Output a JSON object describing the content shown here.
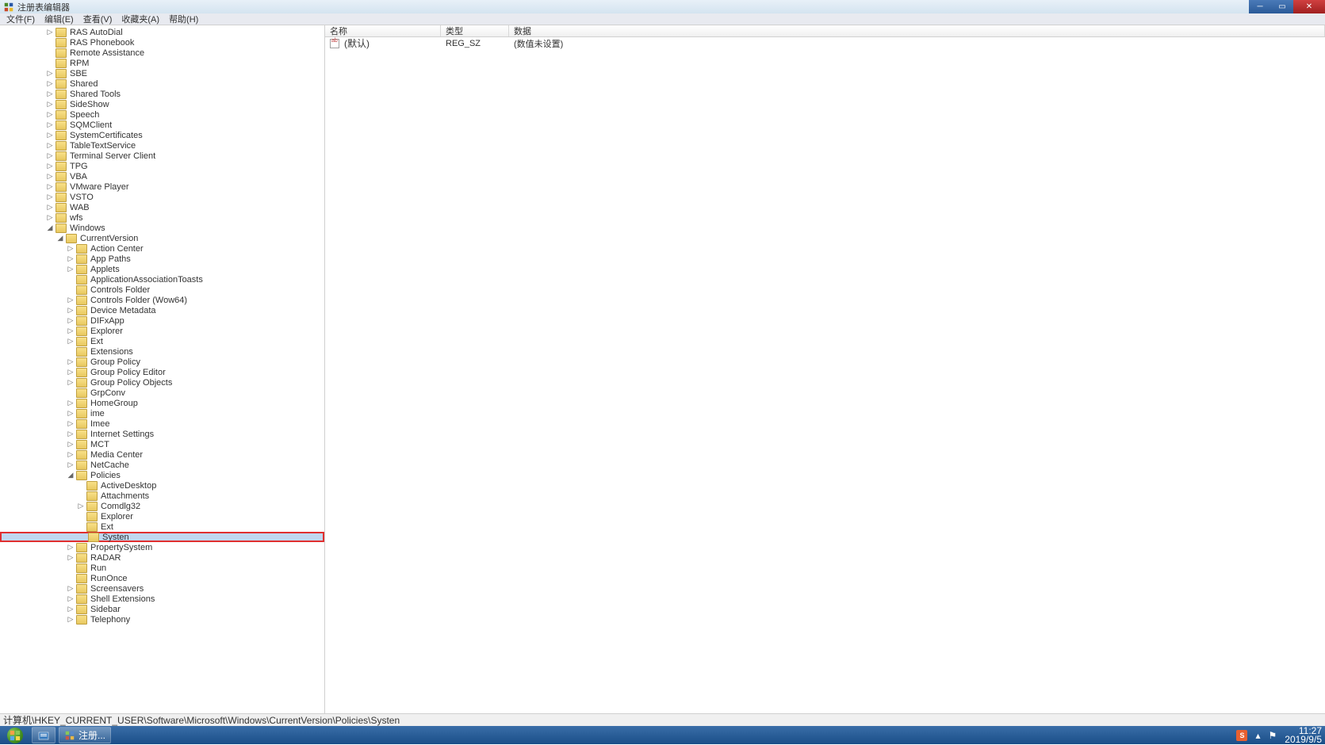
{
  "window": {
    "title": "注册表编辑器"
  },
  "menu": {
    "file": "文件(F)",
    "edit": "编辑(E)",
    "view": "查看(V)",
    "favorites": "收藏夹(A)",
    "help": "帮助(H)"
  },
  "tree": {
    "level0": [
      {
        "label": "RAS AutoDial",
        "expand": "▷"
      },
      {
        "label": "RAS Phonebook",
        "expand": ""
      },
      {
        "label": "Remote Assistance",
        "expand": ""
      },
      {
        "label": "RPM",
        "expand": ""
      },
      {
        "label": "SBE",
        "expand": "▷"
      },
      {
        "label": "Shared",
        "expand": "▷"
      },
      {
        "label": "Shared Tools",
        "expand": "▷"
      },
      {
        "label": "SideShow",
        "expand": "▷"
      },
      {
        "label": "Speech",
        "expand": "▷"
      },
      {
        "label": "SQMClient",
        "expand": "▷"
      },
      {
        "label": "SystemCertificates",
        "expand": "▷"
      },
      {
        "label": "TableTextService",
        "expand": "▷"
      },
      {
        "label": "Terminal Server Client",
        "expand": "▷"
      },
      {
        "label": "TPG",
        "expand": "▷"
      },
      {
        "label": "VBA",
        "expand": "▷"
      },
      {
        "label": "VMware Player",
        "expand": "▷"
      },
      {
        "label": "VSTO",
        "expand": "▷"
      },
      {
        "label": "WAB",
        "expand": "▷"
      },
      {
        "label": "wfs",
        "expand": "▷"
      }
    ],
    "windows": {
      "label": "Windows",
      "expand": "◢"
    },
    "currentversion": {
      "label": "CurrentVersion",
      "expand": "◢"
    },
    "level2": [
      {
        "label": "Action Center",
        "expand": "▷"
      },
      {
        "label": "App Paths",
        "expand": "▷"
      },
      {
        "label": "Applets",
        "expand": "▷"
      },
      {
        "label": "ApplicationAssociationToasts",
        "expand": ""
      },
      {
        "label": "Controls Folder",
        "expand": ""
      },
      {
        "label": "Controls Folder (Wow64)",
        "expand": "▷"
      },
      {
        "label": "Device Metadata",
        "expand": "▷"
      },
      {
        "label": "DIFxApp",
        "expand": "▷"
      },
      {
        "label": "Explorer",
        "expand": "▷"
      },
      {
        "label": "Ext",
        "expand": "▷"
      },
      {
        "label": "Extensions",
        "expand": ""
      },
      {
        "label": "Group Policy",
        "expand": "▷"
      },
      {
        "label": "Group Policy Editor",
        "expand": "▷"
      },
      {
        "label": "Group Policy Objects",
        "expand": "▷"
      },
      {
        "label": "GrpConv",
        "expand": ""
      },
      {
        "label": "HomeGroup",
        "expand": "▷"
      },
      {
        "label": "ime",
        "expand": "▷"
      },
      {
        "label": "Imee",
        "expand": "▷"
      },
      {
        "label": "Internet Settings",
        "expand": "▷"
      },
      {
        "label": "MCT",
        "expand": "▷"
      },
      {
        "label": "Media Center",
        "expand": "▷"
      },
      {
        "label": "NetCache",
        "expand": "▷"
      }
    ],
    "policies": {
      "label": "Policies",
      "expand": "◢"
    },
    "level3": [
      {
        "label": "ActiveDesktop",
        "expand": ""
      },
      {
        "label": "Attachments",
        "expand": ""
      },
      {
        "label": "Comdlg32",
        "expand": "▷"
      },
      {
        "label": "Explorer",
        "expand": ""
      },
      {
        "label": "Ext",
        "expand": ""
      },
      {
        "label": "Systen",
        "expand": "",
        "highlighted": true
      }
    ],
    "level2b": [
      {
        "label": "PropertySystem",
        "expand": "▷"
      },
      {
        "label": "RADAR",
        "expand": "▷"
      },
      {
        "label": "Run",
        "expand": ""
      },
      {
        "label": "RunOnce",
        "expand": ""
      },
      {
        "label": "Screensavers",
        "expand": "▷"
      },
      {
        "label": "Shell Extensions",
        "expand": "▷"
      },
      {
        "label": "Sidebar",
        "expand": "▷"
      },
      {
        "label": "Telephony",
        "expand": "▷"
      }
    ]
  },
  "list": {
    "headers": {
      "name": "名称",
      "type": "类型",
      "data": "数据"
    },
    "rows": [
      {
        "name": "(默认)",
        "type": "REG_SZ",
        "data": "(数值未设置)"
      }
    ]
  },
  "statusbar": {
    "path": "计算机\\HKEY_CURRENT_USER\\Software\\Microsoft\\Windows\\CurrentVersion\\Policies\\Systen"
  },
  "taskbar": {
    "app1": "注册...",
    "tray": {
      "time": "11:27",
      "date": "2019/9/5"
    }
  }
}
